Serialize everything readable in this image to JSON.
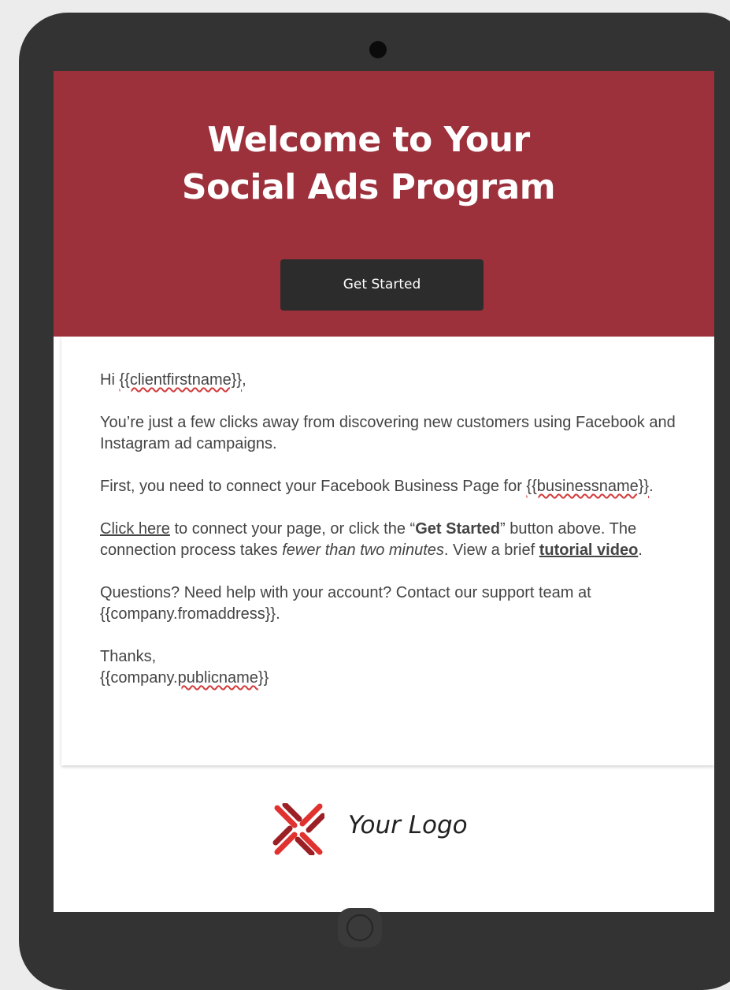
{
  "hero": {
    "title_line1": "Welcome to Your",
    "title_line2": "Social Ads Program",
    "button_label": "Get Started"
  },
  "email": {
    "greeting": "Hi {{clientfirstname}},",
    "greeting_prefix": "Hi ",
    "greeting_var": "{{clientfirstname}}",
    "greeting_suffix": ",",
    "p1": "You’re just a few clicks away from discovering new customers using Facebook and Instagram ad campaigns.",
    "p2_prefix": "First, you need to connect your Facebook Business Page for ",
    "p2_var": "{{businessname}}",
    "p2_suffix": ".",
    "p3_link": "Click here",
    "p3_text1": " to connect your page, or click the “",
    "p3_bold": "Get Started",
    "p3_text2": "” button above. The connection process takes ",
    "p3_italic": "fewer than two minutes",
    "p3_text3": ". View a brief ",
    "p3_video_link": "tutorial video",
    "p3_end": ".",
    "p4": "Questions? Need help with your account? Contact our support team at {{company.fromaddress}}.",
    "signoff": "Thanks,",
    "signature_prefix": "{{company.",
    "signature_var": "publicname",
    "signature_suffix": "}}"
  },
  "footer": {
    "logo_text": "Your Logo",
    "logo_icon": "cross-x-logo-icon"
  },
  "colors": {
    "hero_bg": "#9c313c",
    "button_bg": "#2c2c2c",
    "tablet_frame": "#333333",
    "logo_red": "#e0322f",
    "logo_dark_red": "#9b1f24"
  }
}
